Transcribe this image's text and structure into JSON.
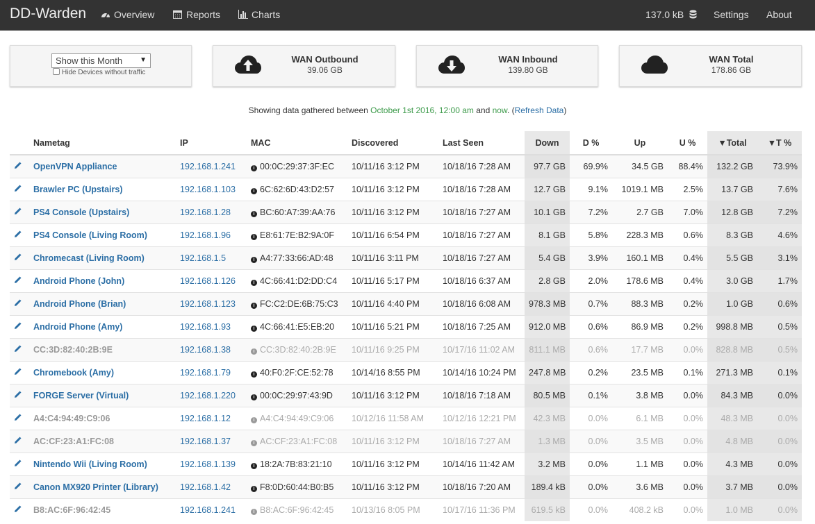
{
  "nav": {
    "brand": "DD-Warden",
    "overview": "Overview",
    "reports": "Reports",
    "charts": "Charts",
    "storage": "137.0 kB",
    "settings": "Settings",
    "about": "About"
  },
  "filter": {
    "period": "Show this Month",
    "hide_label": "Hide Devices without traffic"
  },
  "stats": {
    "outbound": {
      "title": "WAN Outbound",
      "value": "39.06 GB"
    },
    "inbound": {
      "title": "WAN Inbound",
      "value": "139.80 GB"
    },
    "total": {
      "title": "WAN Total",
      "value": "178.86 GB"
    }
  },
  "info": {
    "prefix": "Showing data gathered between ",
    "start": "October 1st 2016, 12:00 am",
    "and": " and ",
    "end": "now",
    "mid": ". (",
    "refresh": "Refresh Data",
    "suffix": ")"
  },
  "table": {
    "headers": {
      "nametag": "Nametag",
      "ip": "IP",
      "mac": "MAC",
      "discovered": "Discovered",
      "last_seen": "Last Seen",
      "down": "Down",
      "d_pct": "D %",
      "up": "Up",
      "u_pct": "U %",
      "total": "▼Total",
      "t_pct": "▼T %"
    },
    "rows": [
      {
        "name": "OpenVPN Appliance",
        "ip": "192.168.1.241",
        "mac": "00:0C:29:37:3F:EC",
        "discovered": "10/11/16 3:12 PM",
        "last_seen": "10/18/16 7:28 AM",
        "down": "97.7 GB",
        "d_pct": "69.9%",
        "up": "34.5 GB",
        "u_pct": "88.4%",
        "total": "132.2 GB",
        "t_pct": "73.9%",
        "inactive": false
      },
      {
        "name": "Brawler PC (Upstairs)",
        "ip": "192.168.1.103",
        "mac": "6C:62:6D:43:D2:57",
        "discovered": "10/11/16 3:12 PM",
        "last_seen": "10/18/16 7:28 AM",
        "down": "12.7 GB",
        "d_pct": "9.1%",
        "up": "1019.1 MB",
        "u_pct": "2.5%",
        "total": "13.7 GB",
        "t_pct": "7.6%",
        "inactive": false
      },
      {
        "name": "PS4 Console (Upstairs)",
        "ip": "192.168.1.28",
        "mac": "BC:60:A7:39:AA:76",
        "discovered": "10/11/16 3:12 PM",
        "last_seen": "10/18/16 7:27 AM",
        "down": "10.1 GB",
        "d_pct": "7.2%",
        "up": "2.7 GB",
        "u_pct": "7.0%",
        "total": "12.8 GB",
        "t_pct": "7.2%",
        "inactive": false
      },
      {
        "name": "PS4 Console (Living Room)",
        "ip": "192.168.1.96",
        "mac": "E8:61:7E:B2:9A:0F",
        "discovered": "10/11/16 6:54 PM",
        "last_seen": "10/18/16 7:27 AM",
        "down": "8.1 GB",
        "d_pct": "5.8%",
        "up": "228.3 MB",
        "u_pct": "0.6%",
        "total": "8.3 GB",
        "t_pct": "4.6%",
        "inactive": false
      },
      {
        "name": "Chromecast (Living Room)",
        "ip": "192.168.1.5",
        "mac": "A4:77:33:66:AD:48",
        "discovered": "10/11/16 3:11 PM",
        "last_seen": "10/18/16 7:27 AM",
        "down": "5.4 GB",
        "d_pct": "3.9%",
        "up": "160.1 MB",
        "u_pct": "0.4%",
        "total": "5.5 GB",
        "t_pct": "3.1%",
        "inactive": false
      },
      {
        "name": "Android Phone (John)",
        "ip": "192.168.1.126",
        "mac": "4C:66:41:D2:DD:C4",
        "discovered": "10/11/16 5:17 PM",
        "last_seen": "10/18/16 6:37 AM",
        "down": "2.8 GB",
        "d_pct": "2.0%",
        "up": "178.6 MB",
        "u_pct": "0.4%",
        "total": "3.0 GB",
        "t_pct": "1.7%",
        "inactive": false
      },
      {
        "name": "Android Phone (Brian)",
        "ip": "192.168.1.123",
        "mac": "FC:C2:DE:6B:75:C3",
        "discovered": "10/11/16 4:40 PM",
        "last_seen": "10/18/16 6:08 AM",
        "down": "978.3 MB",
        "d_pct": "0.7%",
        "up": "88.3 MB",
        "u_pct": "0.2%",
        "total": "1.0 GB",
        "t_pct": "0.6%",
        "inactive": false
      },
      {
        "name": "Android Phone (Amy)",
        "ip": "192.168.1.93",
        "mac": "4C:66:41:E5:EB:20",
        "discovered": "10/11/16 5:21 PM",
        "last_seen": "10/18/16 7:25 AM",
        "down": "912.0 MB",
        "d_pct": "0.6%",
        "up": "86.9 MB",
        "u_pct": "0.2%",
        "total": "998.8 MB",
        "t_pct": "0.5%",
        "inactive": false
      },
      {
        "name": "CC:3D:82:40:2B:9E",
        "ip": "192.168.1.38",
        "mac": "CC:3D:82:40:2B:9E",
        "discovered": "10/11/16 9:25 PM",
        "last_seen": "10/17/16 11:02 AM",
        "down": "811.1 MB",
        "d_pct": "0.6%",
        "up": "17.7 MB",
        "u_pct": "0.0%",
        "total": "828.8 MB",
        "t_pct": "0.5%",
        "inactive": true
      },
      {
        "name": "Chromebook (Amy)",
        "ip": "192.168.1.79",
        "mac": "40:F0:2F:CE:52:78",
        "discovered": "10/14/16 8:55 PM",
        "last_seen": "10/14/16 10:24 PM",
        "down": "247.8 MB",
        "d_pct": "0.2%",
        "up": "23.5 MB",
        "u_pct": "0.1%",
        "total": "271.3 MB",
        "t_pct": "0.1%",
        "inactive": false
      },
      {
        "name": "FORGE Server (Virtual)",
        "ip": "192.168.1.220",
        "mac": "00:0C:29:97:43:9D",
        "discovered": "10/11/16 3:12 PM",
        "last_seen": "10/18/16 7:18 AM",
        "down": "80.5 MB",
        "d_pct": "0.1%",
        "up": "3.8 MB",
        "u_pct": "0.0%",
        "total": "84.3 MB",
        "t_pct": "0.0%",
        "inactive": false
      },
      {
        "name": "A4:C4:94:49:C9:06",
        "ip": "192.168.1.12",
        "mac": "A4:C4:94:49:C9:06",
        "discovered": "10/12/16 11:58 AM",
        "last_seen": "10/12/16 12:21 PM",
        "down": "42.3 MB",
        "d_pct": "0.0%",
        "up": "6.1 MB",
        "u_pct": "0.0%",
        "total": "48.3 MB",
        "t_pct": "0.0%",
        "inactive": true
      },
      {
        "name": "AC:CF:23:A1:FC:08",
        "ip": "192.168.1.37",
        "mac": "AC:CF:23:A1:FC:08",
        "discovered": "10/11/16 3:12 PM",
        "last_seen": "10/18/16 7:27 AM",
        "down": "1.3 MB",
        "d_pct": "0.0%",
        "up": "3.5 MB",
        "u_pct": "0.0%",
        "total": "4.8 MB",
        "t_pct": "0.0%",
        "inactive": true
      },
      {
        "name": "Nintendo Wii (Living Room)",
        "ip": "192.168.1.139",
        "mac": "18:2A:7B:83:21:10",
        "discovered": "10/11/16 3:12 PM",
        "last_seen": "10/14/16 11:42 AM",
        "down": "3.2 MB",
        "d_pct": "0.0%",
        "up": "1.1 MB",
        "u_pct": "0.0%",
        "total": "4.3 MB",
        "t_pct": "0.0%",
        "inactive": false
      },
      {
        "name": "Canon MX920 Printer (Library)",
        "ip": "192.168.1.42",
        "mac": "F8:0D:60:44:B0:B5",
        "discovered": "10/11/16 3:12 PM",
        "last_seen": "10/18/16 7:20 AM",
        "down": "189.4 kB",
        "d_pct": "0.0%",
        "up": "3.6 MB",
        "u_pct": "0.0%",
        "total": "3.7 MB",
        "t_pct": "0.0%",
        "inactive": false
      },
      {
        "name": "B8:AC:6F:96:42:45",
        "ip": "192.168.1.241",
        "mac": "B8:AC:6F:96:42:45",
        "discovered": "10/13/16 8:05 PM",
        "last_seen": "10/17/16 11:36 PM",
        "down": "619.5 kB",
        "d_pct": "0.0%",
        "up": "408.2 kB",
        "u_pct": "0.0%",
        "total": "1.0 MB",
        "t_pct": "0.0%",
        "inactive": true
      }
    ]
  }
}
